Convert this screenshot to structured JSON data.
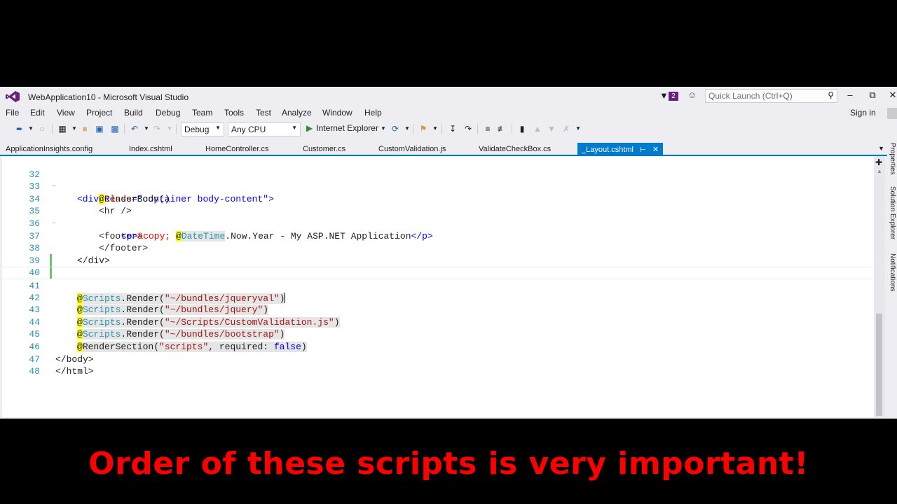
{
  "window": {
    "title": "WebApplication10 - Microsoft Visual Studio",
    "notification_count": "2",
    "quick_launch_placeholder": "Quick Launch (Ctrl+Q)",
    "minimize": "–",
    "restore": "⧉",
    "close": "✕"
  },
  "menu": {
    "items": [
      "File",
      "Edit",
      "View",
      "Project",
      "Build",
      "Debug",
      "Team",
      "Tools",
      "Test",
      "Analyze",
      "Window",
      "Help"
    ],
    "sign_in": "Sign in"
  },
  "toolbar": {
    "configuration": "Debug",
    "platform": "Any CPU",
    "run_target": "Internet Explorer"
  },
  "tabs": [
    {
      "label": "ApplicationInsights.config",
      "active": false
    },
    {
      "label": "Index.cshtml",
      "active": false
    },
    {
      "label": "HomeController.cs",
      "active": false
    },
    {
      "label": "Customer.cs",
      "active": false
    },
    {
      "label": "CustomValidation.js",
      "active": false
    },
    {
      "label": "ValidateCheckBox.cs",
      "active": false
    },
    {
      "label": "_Layout.cshtml",
      "active": true
    }
  ],
  "side_tabs": [
    "Properties",
    "Solution Explorer",
    "Notifications"
  ],
  "editor": {
    "line_numbers": [
      "32",
      "33",
      "34",
      "35",
      "36",
      "37",
      "38",
      "39",
      "40",
      "41",
      "42",
      "43",
      "44",
      "45",
      "46",
      "47",
      "48"
    ],
    "lines": {
      "l32": {
        "tag_open": "<div",
        "attr": "class",
        "eq": "=",
        "value": "\"container body-content\"",
        "tag_close": ">"
      },
      "l33": {
        "at": "@",
        "text": "RenderBody()"
      },
      "l34": {
        "text": "<hr />"
      },
      "l35": {
        "text": "<footer>"
      },
      "l36": {
        "p_open": "<p>",
        "entity": "&copy;",
        "at": "@",
        "razor": "DateTime",
        "rest": ".Now.Year - My ASP.NET Application",
        "p_close": "</p>"
      },
      "l37": {
        "text": "</footer>"
      },
      "l38": {
        "text": "</div>"
      },
      "l41": {
        "at": "@",
        "razor": "Scripts",
        "call": ".Render(",
        "str": "\"~/bundles/jqueryval\"",
        "close": ")"
      },
      "l42": {
        "at": "@",
        "razor": "Scripts",
        "call": ".Render(",
        "str": "\"~/bundles/jquery\"",
        "close": ")"
      },
      "l43": {
        "at": "@",
        "razor": "Scripts",
        "call": ".Render(",
        "str": "\"~/Scripts/CustomValidation.js\"",
        "close": ")"
      },
      "l44": {
        "at": "@",
        "razor": "Scripts",
        "call": ".Render(",
        "str": "\"~/bundles/bootstrap\"",
        "close": ")"
      },
      "l45": {
        "at": "@",
        "fn": "RenderSection(",
        "str": "\"scripts\"",
        "mid": ", required: ",
        "kw": "false",
        "close": ")"
      },
      "l46": {
        "text": "</body>"
      },
      "l47": {
        "text": "</html>"
      }
    }
  },
  "caption": "Order of these scripts is very important!",
  "colors": {
    "accent": "#007acc",
    "caption": "#ff0000",
    "line_number": "#2b91af",
    "string": "#a31515",
    "keyword": "#0000ff",
    "razor_at": "#ffff00"
  }
}
